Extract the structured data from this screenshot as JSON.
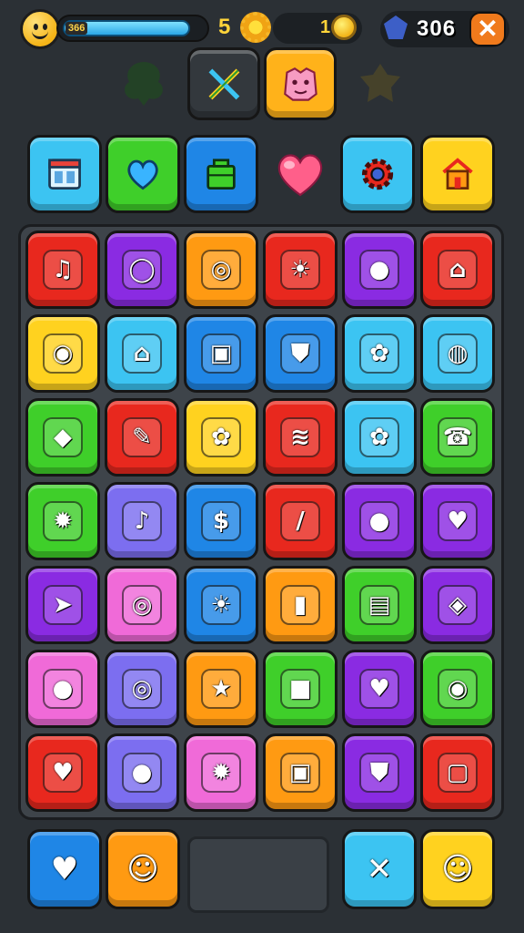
{
  "hud": {
    "level_tag": "366",
    "xp_progress": 0.92,
    "stars_count": "5",
    "coins_count": "1",
    "gems_count": "306",
    "close_label": "✕"
  },
  "palette": {
    "cyan": "#3cc4f2",
    "green": "#3fcf2a",
    "blue": "#1f86e6",
    "yellow": "#ffd21f",
    "orange": "#ff9a12",
    "red": "#e8281e",
    "purple": "#8a2be2",
    "pink": "#f06ad8",
    "lavender": "#7c6ef0",
    "lime": "#55d62c"
  },
  "top_selection": [
    {
      "name": "crossed-swords",
      "color": "#3a3f44"
    },
    {
      "name": "pink-monster",
      "color": "#ffb21a"
    }
  ],
  "top_row": [
    {
      "name": "window-icon",
      "color": "#3cc4f2"
    },
    {
      "name": "heart-icon",
      "color": "#3fcf2a"
    },
    {
      "name": "basket-icon",
      "color": "#1f86e6"
    },
    {
      "name": "gear-icon",
      "color": "#3cc4f2"
    },
    {
      "name": "house-icon",
      "color": "#ffd21f"
    }
  ],
  "board": [
    [
      {
        "name": "music-note-icon",
        "color": "#e8281e",
        "glyph": "♫"
      },
      {
        "name": "ring-icon",
        "color": "#8a2be2",
        "glyph": "◯"
      },
      {
        "name": "chat-icon",
        "color": "#ff9a12",
        "glyph": "◎"
      },
      {
        "name": "sun-icon",
        "color": "#e8281e",
        "glyph": "☀"
      },
      {
        "name": "speech-bubble-icon",
        "color": "#8a2be2",
        "glyph": "●"
      },
      {
        "name": "shop-icon",
        "color": "#e8281e",
        "glyph": "⌂"
      }
    ],
    [
      {
        "name": "camera-icon",
        "color": "#ffd21f",
        "glyph": "◉"
      },
      {
        "name": "house-icon",
        "color": "#3cc4f2",
        "glyph": "⌂"
      },
      {
        "name": "ticket-icon",
        "color": "#1f86e6",
        "glyph": "▣"
      },
      {
        "name": "shield-icon",
        "color": "#1f86e6",
        "glyph": "⛊"
      },
      {
        "name": "flower-face-icon",
        "color": "#3cc4f2",
        "glyph": "✿"
      },
      {
        "name": "location-ring-icon",
        "color": "#3cc4f2",
        "glyph": "◍"
      }
    ],
    [
      {
        "name": "map-pin-icon",
        "color": "#3fcf2a",
        "glyph": "◆"
      },
      {
        "name": "pencil-icon",
        "color": "#e8281e",
        "glyph": "✎"
      },
      {
        "name": "flower-icon",
        "color": "#ffd21f",
        "glyph": "✿"
      },
      {
        "name": "spring-icon",
        "color": "#e8281e",
        "glyph": "≋"
      },
      {
        "name": "flower-icon",
        "color": "#3cc4f2",
        "glyph": "✿"
      },
      {
        "name": "phone-curl-icon",
        "color": "#3fcf2a",
        "glyph": "☎"
      }
    ],
    [
      {
        "name": "sun-gear-icon",
        "color": "#3fcf2a",
        "glyph": "✹"
      },
      {
        "name": "guitar-icon",
        "color": "#7c6ef0",
        "glyph": "♪"
      },
      {
        "name": "dollar-tag-icon",
        "color": "#1f86e6",
        "glyph": "$"
      },
      {
        "name": "crayon-icon",
        "color": "#e8281e",
        "glyph": "/"
      },
      {
        "name": "drop-icon",
        "color": "#8a2be2",
        "glyph": "●"
      },
      {
        "name": "shield-heart-icon",
        "color": "#8a2be2",
        "glyph": "♥"
      }
    ],
    [
      {
        "name": "arrow-tag-icon",
        "color": "#8a2be2",
        "glyph": "➤"
      },
      {
        "name": "ring-icon",
        "color": "#f06ad8",
        "glyph": "◎"
      },
      {
        "name": "sun-face-icon",
        "color": "#1f86e6",
        "glyph": "☀"
      },
      {
        "name": "bottle-icon",
        "color": "#ff9a12",
        "glyph": "▮"
      },
      {
        "name": "battery-icon",
        "color": "#3fcf2a",
        "glyph": "▤"
      },
      {
        "name": "ticket-icon",
        "color": "#8a2be2",
        "glyph": "◈"
      }
    ],
    [
      {
        "name": "fruit-icon",
        "color": "#f06ad8",
        "glyph": "●"
      },
      {
        "name": "target-icon",
        "color": "#7c6ef0",
        "glyph": "◎"
      },
      {
        "name": "star-icon",
        "color": "#ff9a12",
        "glyph": "★"
      },
      {
        "name": "box-icon",
        "color": "#3fcf2a",
        "glyph": "■"
      },
      {
        "name": "heart-drop-icon",
        "color": "#8a2be2",
        "glyph": "♥"
      },
      {
        "name": "map-pin-icon",
        "color": "#3fcf2a",
        "glyph": "◉"
      }
    ],
    [
      {
        "name": "heart-icon",
        "color": "#e8281e",
        "glyph": "♥"
      },
      {
        "name": "pear-icon",
        "color": "#7c6ef0",
        "glyph": "●"
      },
      {
        "name": "gear-icon",
        "color": "#f06ad8",
        "glyph": "✹"
      },
      {
        "name": "cash-register-icon",
        "color": "#ff9a12",
        "glyph": "▣"
      },
      {
        "name": "shield-icon",
        "color": "#8a2be2",
        "glyph": "⛊"
      },
      {
        "name": "robot-icon",
        "color": "#e8281e",
        "glyph": "▢"
      }
    ]
  ],
  "tray": [
    {
      "name": "heart-icon",
      "color": "#1f86e6",
      "glyph": "♥"
    },
    {
      "name": "smiley-icon",
      "color": "#ff9a12",
      "glyph": "☺"
    },
    {
      "name": "crossed-tools-icon",
      "color": "#3cc4f2",
      "glyph": "✕"
    },
    {
      "name": "robot-face-icon",
      "color": "#ffd21f",
      "glyph": "☺"
    }
  ]
}
